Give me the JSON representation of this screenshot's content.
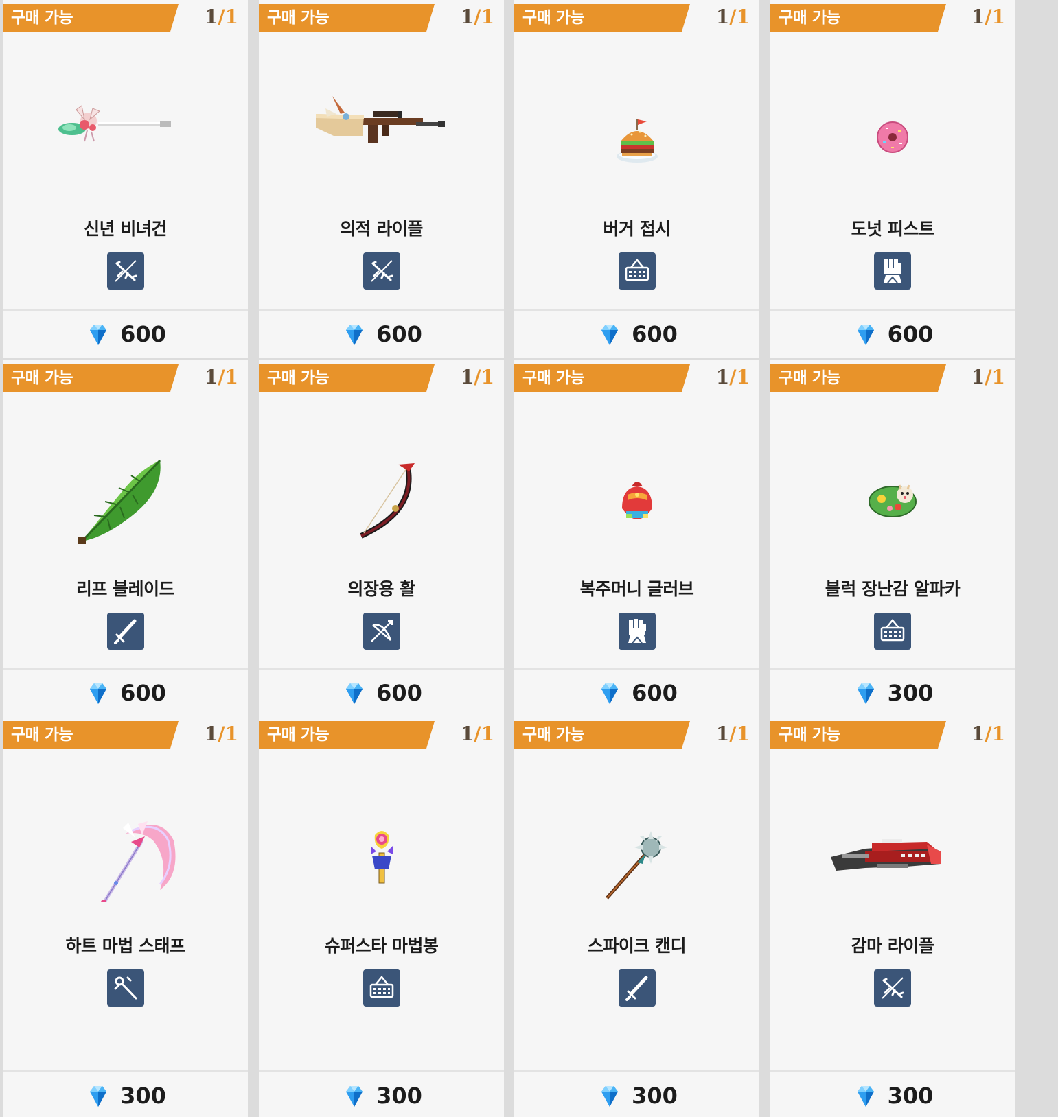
{
  "shop": {
    "items": [
      {
        "status": "구매 가능",
        "limit_current": "1",
        "limit_max": "1",
        "name": "신년 비녀건",
        "type_icon": "gun-icon",
        "price": "600",
        "art": "spear-gun"
      },
      {
        "status": "구매 가능",
        "limit_current": "1",
        "limit_max": "1",
        "name": "의적 라이플",
        "type_icon": "gun-icon",
        "price": "600",
        "art": "rifle"
      },
      {
        "status": "구매 가능",
        "limit_current": "1",
        "limit_max": "1",
        "name": "버거 접시",
        "type_icon": "basket-icon",
        "price": "600",
        "art": "burger"
      },
      {
        "status": "구매 가능",
        "limit_current": "1",
        "limit_max": "1",
        "name": "도넛 피스트",
        "type_icon": "fist-icon",
        "price": "600",
        "art": "donut"
      },
      {
        "status": "구매 가능",
        "limit_current": "1",
        "limit_max": "1",
        "name": "리프 블레이드",
        "type_icon": "sword-icon",
        "price": "600",
        "art": "leaf"
      },
      {
        "status": "구매 가능",
        "limit_current": "1",
        "limit_max": "1",
        "name": "의장용 활",
        "type_icon": "bow-icon",
        "price": "600",
        "art": "bow"
      },
      {
        "status": "구매 가능",
        "limit_current": "1",
        "limit_max": "1",
        "name": "복주머니 글러브",
        "type_icon": "fist-icon",
        "price": "600",
        "art": "pouch"
      },
      {
        "status": "구매 가능",
        "limit_current": "1",
        "limit_max": "1",
        "name": "블럭 장난감 알파카",
        "type_icon": "basket-icon",
        "price": "300",
        "art": "alpaca"
      },
      {
        "status": "구매 가능",
        "limit_current": "1",
        "limit_max": "1",
        "name": "하트 마법 스태프",
        "type_icon": "staff-icon",
        "price": "300",
        "art": "scythe"
      },
      {
        "status": "구매 가능",
        "limit_current": "1",
        "limit_max": "1",
        "name": "슈퍼스타 마법봉",
        "type_icon": "basket-icon",
        "price": "300",
        "art": "wand"
      },
      {
        "status": "구매 가능",
        "limit_current": "1",
        "limit_max": "1",
        "name": "스파이크 캔디",
        "type_icon": "sword-icon",
        "price": "300",
        "art": "mace"
      },
      {
        "status": "구매 가능",
        "limit_current": "1",
        "limit_max": "1",
        "name": "감마 라이플",
        "type_icon": "gun-icon",
        "price": "300",
        "art": "gamma"
      }
    ]
  },
  "colors": {
    "banner": "#e8932a",
    "badge": "#3b5578",
    "gem": "#1e8fe8"
  },
  "currency_icon": "gem-icon"
}
